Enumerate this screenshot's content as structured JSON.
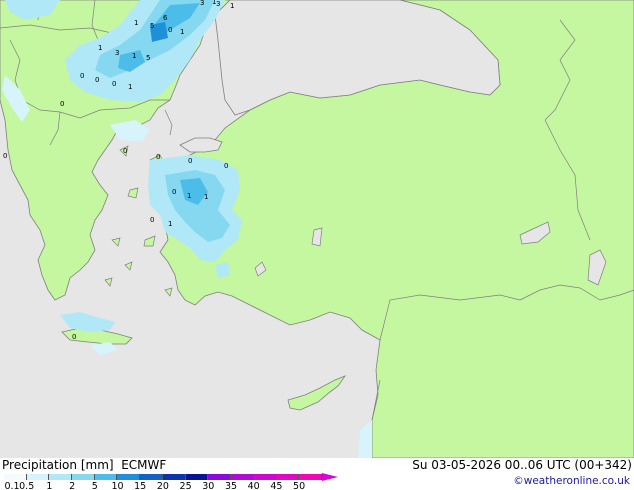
{
  "header": {
    "product_label": "Precipitation [mm]",
    "model_label": "ECMWF",
    "valid_time": "Su 03-05-2026 00..06 UTC (00+342)",
    "credit": "©weatheronline.co.uk"
  },
  "legend": {
    "ticks": [
      "0.1",
      "0.5",
      "1",
      "2",
      "5",
      "10",
      "15",
      "20",
      "25",
      "30",
      "35",
      "40",
      "45",
      "50"
    ],
    "colors": [
      "#f5fbfd",
      "#d7f3fb",
      "#b1e8f7",
      "#86d8f1",
      "#4cbde9",
      "#1e90d8",
      "#1462c2",
      "#0b35a8",
      "#061590",
      "#8c0ad9",
      "#b00ad6",
      "#cb0ad0",
      "#dd0ac4",
      "#ec0ab5"
    ]
  },
  "map": {
    "colors": {
      "sea": "#e6e6e6",
      "land": "#c5f7a1",
      "border": "#7f7f7f",
      "coast": "#7f7f7f"
    },
    "value_labels": [
      "1",
      "5",
      "3",
      "3",
      "1",
      "1",
      "6",
      "0",
      "1",
      "1",
      "3",
      "5",
      "0",
      "1",
      "0",
      "0",
      "1",
      "0",
      "0",
      "0",
      "0",
      "0",
      "0",
      "1",
      "1",
      "1",
      "0",
      "0",
      "0"
    ]
  }
}
